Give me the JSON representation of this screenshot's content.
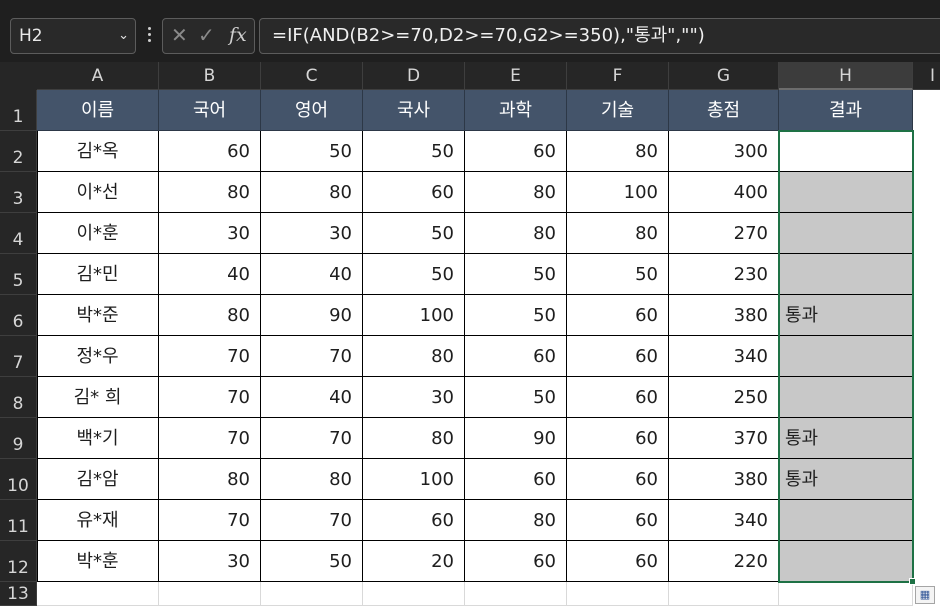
{
  "name_box": {
    "value": "H2"
  },
  "formula_bar": {
    "cancel_icon": "close-icon",
    "enter_icon": "check-icon",
    "fx_label": "fx",
    "formula": "=IF(AND(B2>=70,D2>=70,G2>=350),\"통과\",\"\")"
  },
  "columns": [
    "A",
    "B",
    "C",
    "D",
    "E",
    "F",
    "G",
    "H",
    "I"
  ],
  "selected_column": "H",
  "row_numbers": [
    "1",
    "2",
    "3",
    "4",
    "5",
    "6",
    "7",
    "8",
    "9",
    "10",
    "11",
    "12",
    "13"
  ],
  "table": {
    "headers": [
      "이름",
      "국어",
      "영어",
      "국사",
      "과학",
      "기술",
      "총점",
      "결과"
    ],
    "rows": [
      [
        "김*옥",
        "60",
        "50",
        "50",
        "60",
        "80",
        "300",
        ""
      ],
      [
        "이*선",
        "80",
        "80",
        "60",
        "80",
        "100",
        "400",
        ""
      ],
      [
        "이*훈",
        "30",
        "30",
        "50",
        "80",
        "80",
        "270",
        ""
      ],
      [
        "김*민",
        "40",
        "40",
        "50",
        "50",
        "50",
        "230",
        ""
      ],
      [
        "박*준",
        "80",
        "90",
        "100",
        "50",
        "60",
        "380",
        "통과"
      ],
      [
        "정*우",
        "70",
        "70",
        "80",
        "60",
        "60",
        "340",
        ""
      ],
      [
        "김* 희",
        "70",
        "40",
        "30",
        "50",
        "60",
        "250",
        ""
      ],
      [
        "백*기",
        "70",
        "70",
        "80",
        "90",
        "60",
        "370",
        "통과"
      ],
      [
        "김*암",
        "80",
        "80",
        "100",
        "60",
        "60",
        "380",
        "통과"
      ],
      [
        "유*재",
        "70",
        "70",
        "60",
        "80",
        "60",
        "340",
        ""
      ],
      [
        "박*훈",
        "30",
        "50",
        "20",
        "60",
        "60",
        "220",
        ""
      ]
    ]
  },
  "colors": {
    "header_fill": "#44546a",
    "selection_fill": "#c8c8c8",
    "selection_border": "#1e7145"
  }
}
